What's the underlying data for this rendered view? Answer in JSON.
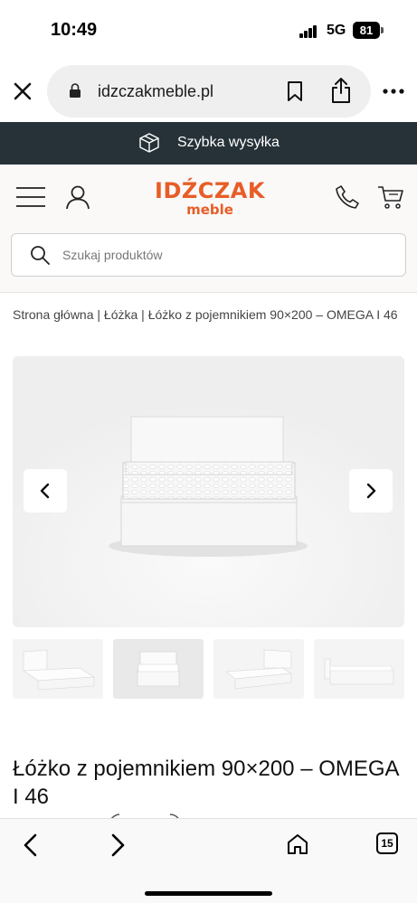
{
  "status_bar": {
    "time": "10:49",
    "network": "5G",
    "battery": "81"
  },
  "browser": {
    "url": "idzczakmeble.pl",
    "tab_count": "15"
  },
  "promo_banner": {
    "text": "Szybka wysyłka"
  },
  "site_header": {
    "logo_main": "IDŹCZAK",
    "logo_sub": "meble",
    "brand_color": "#e85d27",
    "search_placeholder": "Szukaj produktów"
  },
  "breadcrumb": {
    "text": "Strona główna | Łóżka | Łóżko z pojemnikiem 90×200 – OMEGA I 46"
  },
  "gallery": {
    "thumbnail_count": 4,
    "active_thumbnail": 2
  },
  "product": {
    "title": "Łóżko z pojemnikiem 90×200 – OMEGA I 46"
  },
  "icons": {
    "close": "close-icon",
    "lock": "lock-icon",
    "bookmark": "bookmark-icon",
    "share": "share-icon",
    "more": "more-icon",
    "box": "box-icon",
    "menu": "menu-icon",
    "account": "account-icon",
    "phone": "phone-icon",
    "cart": "cart-icon",
    "search": "search-icon",
    "back": "back-icon",
    "forward": "forward-icon",
    "home": "home-icon"
  }
}
